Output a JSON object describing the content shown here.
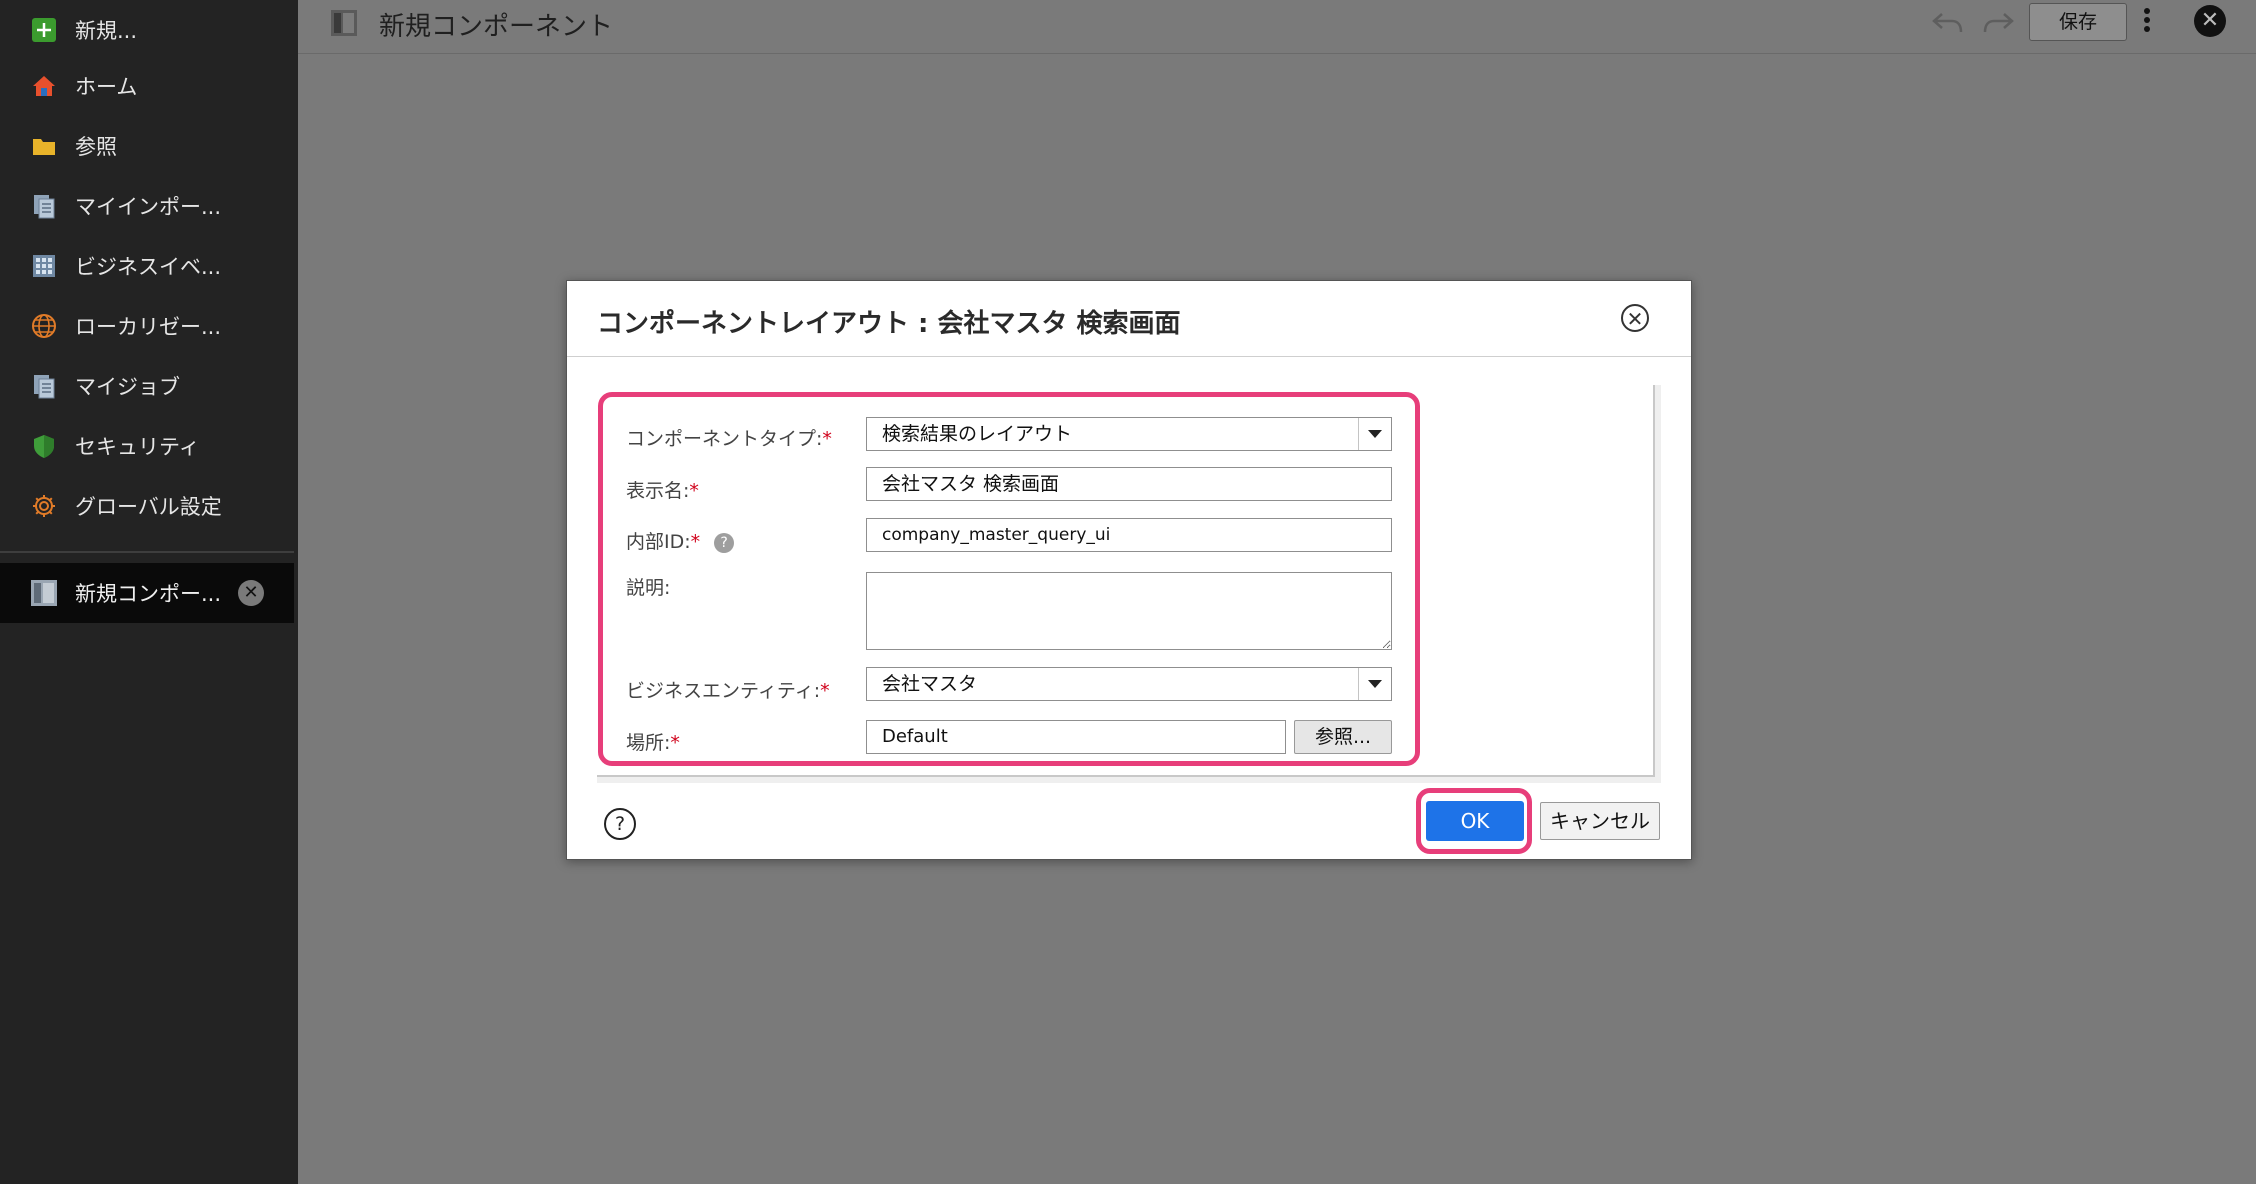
{
  "sidebar": {
    "items": [
      {
        "label": "新規...",
        "icon": "plus-icon"
      },
      {
        "label": "ホーム",
        "icon": "home-icon"
      },
      {
        "label": "参照",
        "icon": "folder-icon"
      },
      {
        "label": "マイインポー...",
        "icon": "document-icon"
      },
      {
        "label": "ビジネスイベ...",
        "icon": "grid-icon"
      },
      {
        "label": "ローカリゼー...",
        "icon": "globe-icon"
      },
      {
        "label": "マイジョブ",
        "icon": "document-icon"
      },
      {
        "label": "セキュリティ",
        "icon": "shield-icon"
      },
      {
        "label": "グローバル設定",
        "icon": "gear-icon"
      }
    ],
    "open_tab": {
      "label": "新規コンポー..."
    }
  },
  "topbar": {
    "title": "新規コンポーネント",
    "save_label": "保存"
  },
  "dialog": {
    "title": "コンポーネントレイアウト : 会社マスタ 検索画面",
    "fields": {
      "component_type": {
        "label": "コンポーネントタイプ:",
        "value": "検索結果のレイアウト"
      },
      "display_name": {
        "label": "表示名:",
        "value": "会社マスタ 検索画面"
      },
      "internal_id": {
        "label": "内部ID:",
        "value": "company_master_query_ui"
      },
      "description": {
        "label": "説明:",
        "value": ""
      },
      "business_entity": {
        "label": "ビジネスエンティティ:",
        "value": "会社マスタ"
      },
      "location": {
        "label": "場所:",
        "value": "Default",
        "browse_label": "参照..."
      }
    },
    "required_mark": "*",
    "help_mark": "?",
    "ok_label": "OK",
    "cancel_label": "キャンセル"
  },
  "colors": {
    "sidebar_bg": "#232323",
    "overlay_bg": "#7a7a7a",
    "primary": "#1e73e8",
    "highlight": "#e73e7a",
    "required": "#d0021b"
  }
}
